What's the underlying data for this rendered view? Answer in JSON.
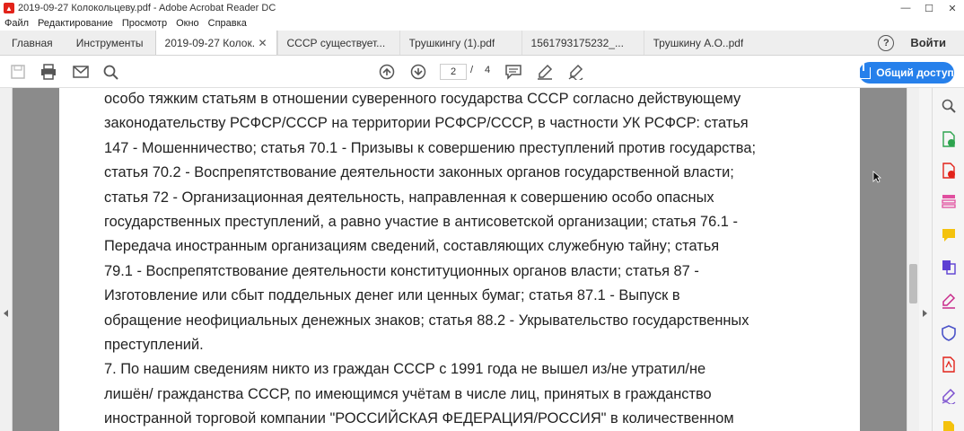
{
  "window": {
    "title": "2019-09-27 Колокольцеву.pdf - Adobe Acrobat Reader DC",
    "minimize": "—",
    "maximize": "☐",
    "close": "✕"
  },
  "menu": [
    "Файл",
    "Редактирование",
    "Просмотр",
    "Окно",
    "Справка"
  ],
  "tabs": {
    "home": "Главная",
    "tools": "Инструменты",
    "documents": [
      {
        "label": "2019-09-27 Колок...",
        "active": true
      },
      {
        "label": "СССР существует..."
      },
      {
        "label": "Трушкингу (1).pdf"
      },
      {
        "label": "1561793175232_..."
      },
      {
        "label": "Трушкину А.О..pdf"
      }
    ],
    "help": "?",
    "signin": "Войти"
  },
  "toolbar": {
    "current_page": "2",
    "page_separator": "/",
    "total_pages": "4",
    "share_label": "Общий доступ"
  },
  "document": {
    "lines": [
      "особо тяжким статьям в отношении суверенного государства СССР согласно действующему",
      "законодательству РСФСР/СССР на территории РСФСР/СССР, в частности УК РСФСР: статья",
      "147 - Мошенничество; статья 70.1 - Призывы к совершению преступлений против государства;",
      "статья 70.2 - Воспрепятствование деятельности законных органов государственной власти;",
      "статья 72 - Организационная деятельность, направленная к совершению особо опасных",
      "государственных преступлений, а равно участие в антисоветской организации; статья 76.1 -",
      "Передача иностранным организациям сведений, составляющих служебную тайну; статья",
      "79.1 - Воспрепятствование деятельности конституционных органов власти; статья 87 -",
      "Изготовление или сбыт поддельных денег или ценных бумаг; статья 87.1 - Выпуск в",
      "обращение неофициальных денежных знаков; статья 88.2 - Укрывательство государственных",
      "преступлений.",
      "7. По нашим сведениям никто из граждан СССР с 1991 года не вышел из/не утратил/не",
      "лишён/ гражданства СССР, по имеющимся учётам в числе лиц, принятых в гражданство",
      "иностранной торговой компании \"РОССИЙСКАЯ ФЕДЕРАЦИЯ/РОССИЯ\" в количественном"
    ]
  },
  "colors": {
    "accent": "#2680eb",
    "doc_background": "#8b8b8b"
  }
}
